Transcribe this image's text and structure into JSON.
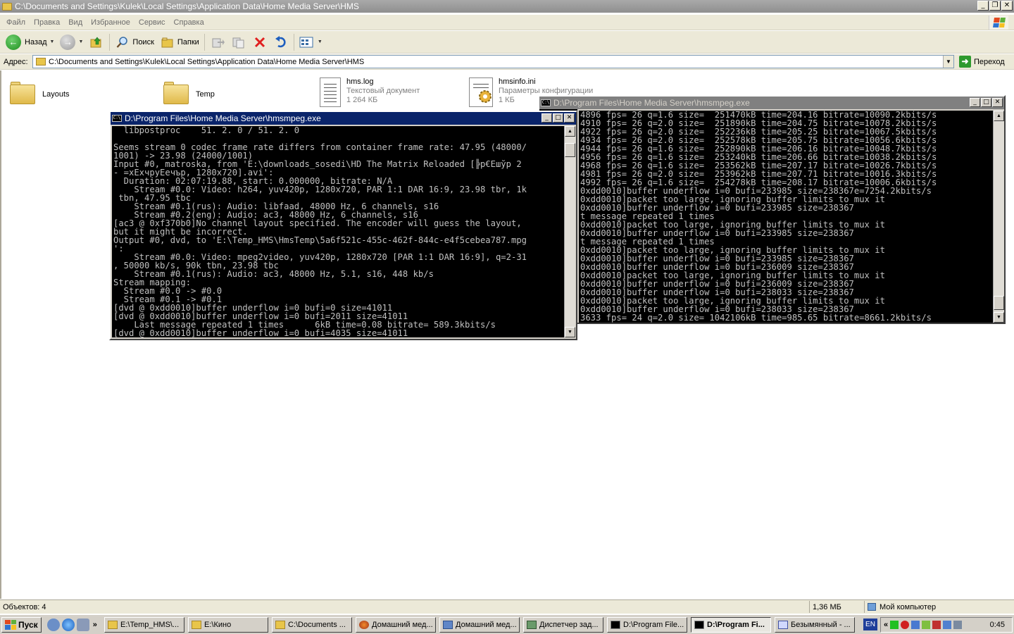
{
  "explorer": {
    "title": "C:\\Documents and Settings\\Kulek\\Local Settings\\Application Data\\Home Media Server\\HMS",
    "menu": [
      "Файл",
      "Правка",
      "Вид",
      "Избранное",
      "Сервис",
      "Справка"
    ],
    "toolbar": {
      "back": "Назад",
      "search": "Поиск",
      "folders": "Папки"
    },
    "address_label": "Адрес:",
    "address_value": "C:\\Documents and Settings\\Kulek\\Local Settings\\Application Data\\Home Media Server\\HMS",
    "go_label": "Переход",
    "files": [
      {
        "name": "Layouts"
      },
      {
        "name": "Temp"
      },
      {
        "name": "hms.log",
        "type": "Текстовый документ",
        "size": "1 264 КБ"
      },
      {
        "name": "hmsinfo.ini",
        "type": "Параметры конфигурации",
        "size": "1 КБ"
      }
    ],
    "status": {
      "objects": "Объектов: 4",
      "size": "1,36 МБ",
      "location": "Мой компьютер"
    }
  },
  "console_left": {
    "title": "D:\\Program Files\\Home Media Server\\hmsmpeg.exe",
    "lines": [
      "  libpostproc    51. 2. 0 / 51. 2. 0",
      "",
      "Seems stream 0 codec frame rate differs from container frame rate: 47.95 (48000/",
      "1001) -> 23.98 (24000/1001)",
      "Input #0, matroska, from 'E:\\downloads_sosedi\\HD The Matrix Reloaded [╠р€Ешўр 2",
      "- =xЕхчруЕечър, 1280x720].avi':",
      "  Duration: 02:07:19.88, start: 0.000000, bitrate: N/A",
      "    Stream #0.0: Video: h264, yuv420p, 1280x720, PAR 1:1 DAR 16:9, 23.98 tbr, 1k",
      " tbn, 47.95 tbc",
      "    Stream #0.1(rus): Audio: libfaad, 48000 Hz, 6 channels, s16",
      "    Stream #0.2(eng): Audio: ac3, 48000 Hz, 6 channels, s16",
      "[ac3 @ 0xf370b0]No channel layout specified. The encoder will guess the layout,",
      "but it might be incorrect.",
      "Output #0, dvd, to 'E:\\Temp_HMS\\HmsTemp\\5a6f521c-455c-462f-844c-e4f5cebea787.mpg",
      "':",
      "    Stream #0.0: Video: mpeg2video, yuv420p, 1280x720 [PAR 1:1 DAR 16:9], q=2-31",
      ", 50000 kb/s, 90k tbn, 23.98 tbc",
      "    Stream #0.1(rus): Audio: ac3, 48000 Hz, 5.1, s16, 448 kb/s",
      "Stream mapping:",
      "  Stream #0.0 -> #0.0",
      "  Stream #0.1 -> #0.1",
      "[dvd @ 0xdd0010]buffer underflow i=0 bufi=0 size=41011",
      "[dvd @ 0xdd0010]buffer underflow i=0 bufi=2011 size=41011",
      "    Last message repeated 1 times      6kB time=0.08 bitrate= 589.3kbits/s",
      "[dvd @ 0xdd0010]buffer underflow i=0 bufi=4035 size=41011"
    ]
  },
  "console_right": {
    "title": "D:\\Program Files\\Home Media Server\\hmsmpeg.exe",
    "lines": [
      "4896 fps= 26 q=1.6 size=  251470kB time=204.16 bitrate=10090.2kbits/s",
      "4910 fps= 26 q=2.0 size=  251890kB time=204.75 bitrate=10078.2kbits/s",
      "4922 fps= 26 q=2.0 size=  252236kB time=205.25 bitrate=10067.5kbits/s",
      "4934 fps= 26 q=2.0 size=  252578kB time=205.75 bitrate=10056.6kbits/s",
      "4944 fps= 26 q=1.6 size=  252890kB time=206.16 bitrate=10048.7kbits/s",
      "4956 fps= 26 q=1.6 size=  253240kB time=206.66 bitrate=10038.2kbits/s",
      "4968 fps= 26 q=1.6 size=  253562kB time=207.17 bitrate=10026.7kbits/s",
      "4981 fps= 26 q=2.0 size=  253962kB time=207.71 bitrate=10016.3kbits/s",
      "4992 fps= 26 q=1.6 size=  254278kB time=208.17 bitrate=10006.6kbits/s",
      "0xdd0010]buffer underflow i=0 bufi=233985 size=238367e=7254.2kbits/s",
      "0xdd0010]packet too large, ignoring buffer limits to mux it",
      "0xdd0010]buffer underflow i=0 bufi=233985 size=238367",
      "t message repeated 1 times",
      "0xdd0010]packet too large, ignoring buffer limits to mux it",
      "0xdd0010]buffer underflow i=0 bufi=233985 size=238367",
      "t message repeated 1 times",
      "0xdd0010]packet too large, ignoring buffer limits to mux it",
      "0xdd0010]buffer underflow i=0 bufi=233985 size=238367",
      "0xdd0010]buffer underflow i=0 bufi=236009 size=238367",
      "0xdd0010]packet too large, ignoring buffer limits to mux it",
      "0xdd0010]buffer underflow i=0 bufi=236009 size=238367",
      "0xdd0010]buffer underflow i=0 bufi=238033 size=238367",
      "0xdd0010]packet too large, ignoring buffer limits to mux it",
      "0xdd0010]buffer underflow i=0 bufi=238033 size=238367",
      "3633 fps= 24 q=2.0 size= 1042106kB time=985.65 bitrate=8661.2kbits/s"
    ]
  },
  "taskbar": {
    "start": "Пуск",
    "buttons": [
      "E:\\Temp_HMS\\...",
      "E:\\Кино",
      "C:\\Documents ...",
      "Домашний мед...",
      "Домашний мед...",
      "Диспетчер зад...",
      "D:\\Program File...",
      "D:\\Program Fi...",
      "Безымянный - ..."
    ],
    "lang": "EN",
    "clock": "0:45"
  },
  "colors": {
    "console_bg": "#000000",
    "console_fg": "#c0c0c0",
    "active_title": "#0a246a",
    "inactive_title": "#808080",
    "window_face": "#ece9d8"
  }
}
